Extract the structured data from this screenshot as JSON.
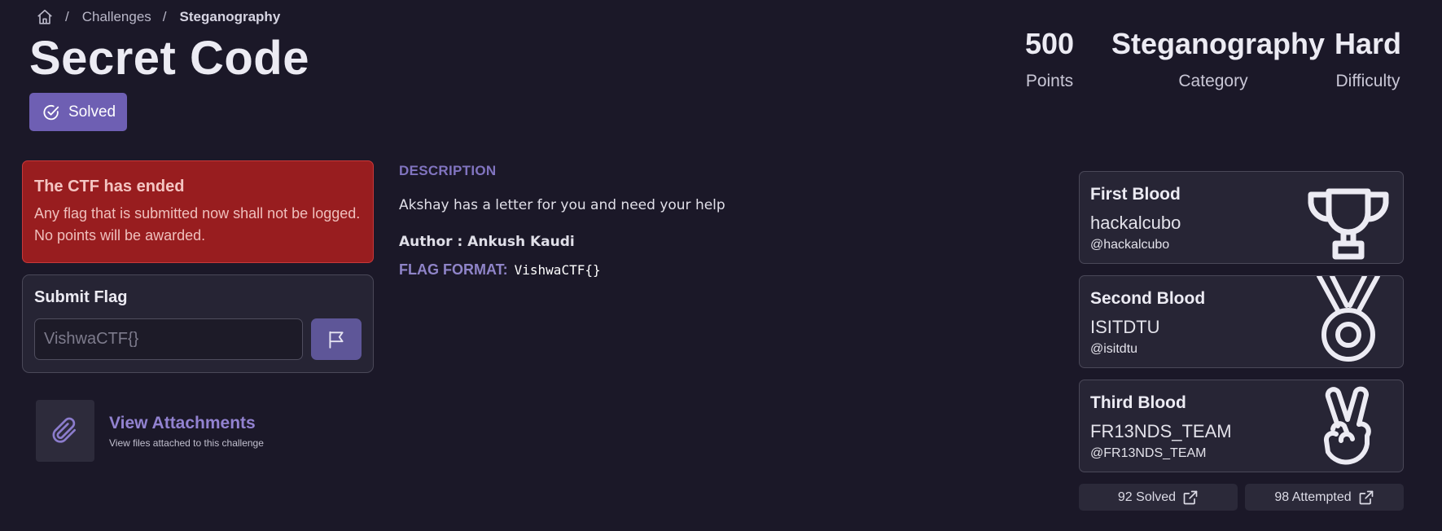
{
  "breadcrumb": {
    "home_icon": "home-icon",
    "sep": "/",
    "challenges": "Challenges",
    "current": "Steganography"
  },
  "challenge": {
    "title": "Secret Code",
    "solved_label": "Solved"
  },
  "stats": {
    "points_value": "500",
    "points_label": "Points",
    "category_value": "Steganography",
    "category_label": "Category",
    "difficulty_value": "Hard",
    "difficulty_label": "Difficulty"
  },
  "alert": {
    "title": "The CTF has ended",
    "text": "Any flag that is submitted now shall not be logged. No points will be awarded."
  },
  "submit": {
    "title": "Submit Flag",
    "placeholder": "VishwaCTF{}"
  },
  "attachments": {
    "title": "View Attachments",
    "subtitle": "View files attached to this challenge"
  },
  "description": {
    "heading": "DESCRIPTION",
    "body": "Akshay has a letter for you and need your help",
    "author": "Author : Ankush Kaudi",
    "flag_format_label": "FLAG FORMAT:",
    "flag_format_value": "VishwaCTF{}"
  },
  "bloods": {
    "first": {
      "title": "First Blood",
      "team": "hackalcubo",
      "handle": "@hackalcubo",
      "icon": "trophy-icon"
    },
    "second": {
      "title": "Second Blood",
      "team": "ISITDTU",
      "handle": "@isitdtu",
      "icon": "medal-icon"
    },
    "third": {
      "title": "Third Blood",
      "team": "FR13NDS_TEAM",
      "handle": "@FR13NDS_TEAM",
      "icon": "victory-hand-icon"
    }
  },
  "counts": {
    "solved": "92 Solved",
    "attempted": "98 Attempted"
  },
  "colors": {
    "background": "#1b1828",
    "accent": "#6e5fb3",
    "alert": "#981d1f"
  }
}
